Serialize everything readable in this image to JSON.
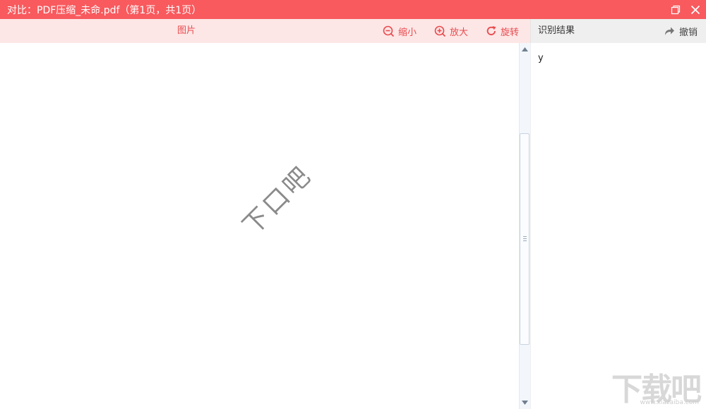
{
  "window": {
    "title": "对比：PDF压缩_未命.pdf（第1页，共1页）"
  },
  "left_panel": {
    "label": "图片",
    "zoom_out_label": "缩小",
    "zoom_in_label": "放大",
    "rotate_label": "旋转",
    "watermark_text": "下口吧"
  },
  "right_panel": {
    "label": "识别结果",
    "undo_label": "撤销",
    "result_text": "y"
  },
  "site_watermark": {
    "logo_text": "下载吧",
    "url_text": "www.xiazaiba.com"
  },
  "colors": {
    "accent": "#f85a5e",
    "toolbar_bg": "#fde6e6",
    "tool_text": "#e84c4f"
  },
  "icons": {
    "restore": "restore-icon",
    "close": "close-icon",
    "zoom_out": "zoom-out-icon",
    "zoom_in": "zoom-in-icon",
    "rotate": "rotate-icon",
    "undo": "undo-arrow-icon"
  }
}
